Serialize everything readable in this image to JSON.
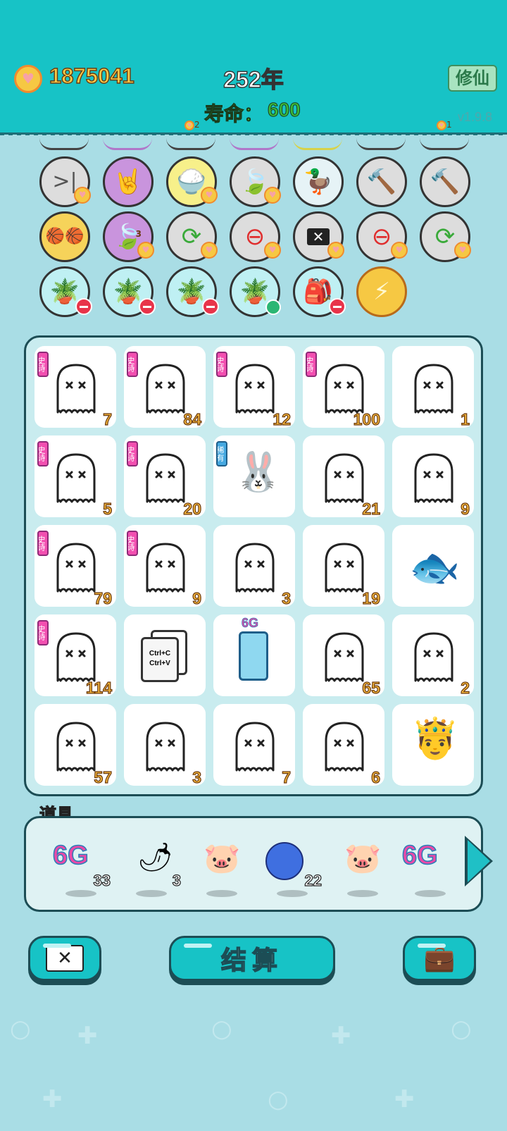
{
  "header": {
    "coins": "1875041",
    "year": "252年",
    "lifespan_label": "寿命：",
    "lifespan_value": "600",
    "cultivate_label": "修仙",
    "version": "v1.9.8",
    "cost_left": "2",
    "cost_right": "1"
  },
  "skills": {
    "row1": [
      "skip-icon",
      "rock-hand-icon",
      "rice-bowl-icon",
      "leaf-coin-icon",
      "duck-pot-icon",
      "hammer-icon",
      "hammer-icon"
    ],
    "row2": [
      "basketballs-icon",
      "leaf-icon",
      "refresh-icon",
      "minus-circle-icon",
      "delete-tag-icon",
      "minus-circle-icon",
      "refresh-icon"
    ],
    "row3": [
      "flower-pot-icon",
      "flower-pot-icon",
      "flower-pot-icon",
      "flower-pot-icon",
      "bag-icon",
      "lightning-icon"
    ],
    "leaf_count": "3"
  },
  "grid": {
    "tag_epic": "史诗",
    "tag_rare": "稀有",
    "fridge_label": "6G",
    "copy_label": "Ctrl+C",
    "paste_label": "Ctrl+V",
    "cells": [
      {
        "item": "ghost",
        "count": "7",
        "tag": "epic"
      },
      {
        "item": "ghost",
        "count": "84",
        "tag": "epic"
      },
      {
        "item": "ghost",
        "count": "12",
        "tag": "epic"
      },
      {
        "item": "ghost",
        "count": "100",
        "tag": "epic"
      },
      {
        "item": "ghost",
        "count": "1",
        "tag": ""
      },
      {
        "item": "ghost",
        "count": "5",
        "tag": "epic"
      },
      {
        "item": "ghost",
        "count": "20",
        "tag": "epic"
      },
      {
        "item": "rabbit",
        "count": "",
        "tag": "rare"
      },
      {
        "item": "ghost",
        "count": "21",
        "tag": ""
      },
      {
        "item": "ghost",
        "count": "9",
        "tag": ""
      },
      {
        "item": "ghost",
        "count": "79",
        "tag": "epic"
      },
      {
        "item": "ghost",
        "count": "9",
        "tag": "epic"
      },
      {
        "item": "ghost",
        "count": "3",
        "tag": ""
      },
      {
        "item": "ghost",
        "count": "19",
        "tag": ""
      },
      {
        "item": "koi",
        "count": "",
        "tag": ""
      },
      {
        "item": "ghost",
        "count": "114",
        "tag": "epic"
      },
      {
        "item": "copy-paste",
        "count": "",
        "tag": ""
      },
      {
        "item": "fridge",
        "count": "",
        "tag": ""
      },
      {
        "item": "ghost",
        "count": "65",
        "tag": ""
      },
      {
        "item": "ghost",
        "count": "2",
        "tag": ""
      },
      {
        "item": "ghost",
        "count": "57",
        "tag": ""
      },
      {
        "item": "ghost",
        "count": "3",
        "tag": ""
      },
      {
        "item": "ghost",
        "count": "7",
        "tag": ""
      },
      {
        "item": "ghost",
        "count": "6",
        "tag": ""
      },
      {
        "item": "king",
        "count": "",
        "tag": ""
      }
    ]
  },
  "props": {
    "title": "道具",
    "items": [
      {
        "icon": "6g-icon",
        "label": "6G",
        "count": "33"
      },
      {
        "icon": "chili-icon",
        "label": "",
        "count": "3"
      },
      {
        "icon": "piggy-bank-icon",
        "label": "",
        "count": ""
      },
      {
        "icon": "blueberry-icon",
        "label": "",
        "count": "22"
      },
      {
        "icon": "piggy-bank-icon",
        "label": "",
        "count": ""
      },
      {
        "icon": "6g-icon",
        "label": "6G",
        "count": ""
      }
    ]
  },
  "buttons": {
    "settle": "结算"
  }
}
